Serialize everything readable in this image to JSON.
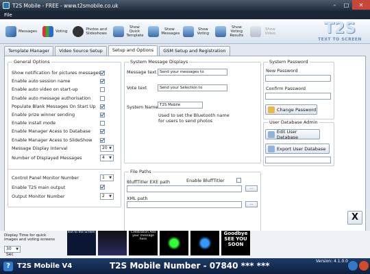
{
  "window": {
    "title": "T2S Mobile - FREE - www.t2smobile.co.uk",
    "menu": "File"
  },
  "toolbar": {
    "messages": "Messages",
    "voting": "Voting",
    "photos": "Photos and Slideshows",
    "show_quick_template": "Show Quick Template",
    "show_messages": "Show Messages",
    "show_voting": "Show Voting",
    "show_voting_results": "Show Voting Results",
    "show_video": "Show Video",
    "logo_text": "T2S",
    "logo_sub": "TEXT TO SCREEN"
  },
  "tabs": [
    "Template Manager",
    "Video Source Setup",
    "Setup and Options",
    "GSM Setup and Registration"
  ],
  "general": {
    "title": "General Options",
    "options": [
      {
        "label": "Show notification for pictures messages",
        "checked": true
      },
      {
        "label": "Enable auto session name",
        "checked": true
      },
      {
        "label": "Enable auto video on start-up",
        "checked": false
      },
      {
        "label": "Enable auto message authorisation",
        "checked": false
      },
      {
        "label": "Populate Blank Messages On Start Up",
        "checked": true
      },
      {
        "label": "Enable prize winner sending",
        "checked": true
      },
      {
        "label": "Enable install mode",
        "checked": false
      },
      {
        "label": "Enable Manager Acess to Database",
        "checked": true
      },
      {
        "label": "Enable Manager Acess to SlideShow",
        "checked": true
      }
    ],
    "interval_label": "Message Display Interval",
    "interval_value": "20",
    "displayed_label": "Number of Displayed Messages",
    "displayed_value": "4",
    "control_panel_label": "Control Panel Monitor Number",
    "control_panel_value": "1",
    "enable_t2s_label": "Enable T2S main output",
    "output_monitor_label": "Output Monitor Number",
    "output_monitor_value": "2"
  },
  "system_message": {
    "title": "System Message Displays",
    "message_text_label": "Message text",
    "message_text_value": "Send your messages to",
    "vote_text_label": "Vote text",
    "vote_text_value": "Send your Selection to",
    "system_name_label": "System Name",
    "system_name_value": "T2S Mobile",
    "hint": "Used to set the Bluetooth name for users to send photos"
  },
  "file_paths": {
    "title": "File Paths",
    "bluff_label": "BluffTitler EXE path",
    "enable_bluff_label": "Enable BluffTitler",
    "xml_label": "XML path",
    "browse": "..."
  },
  "password": {
    "title": "System Password",
    "new_label": "New Password",
    "confirm_label": "Confirm Password",
    "change_button": "Change Password"
  },
  "user_db": {
    "title": "User Database Admin",
    "edit_button": "Edit User Database",
    "export_button": "Export User Database"
  },
  "close_x": "X",
  "bottom": {
    "display_time_label": "Display Time for quick images and voting screens",
    "display_time_value": "30 Sec",
    "thumbs": [
      "Text to the Screen",
      "",
      "Celebration Add your message here",
      "",
      "",
      "Goodbye SEE YOU SOON"
    ]
  },
  "status": {
    "brand": "T2S Mobile V4",
    "number": "T2S Mobile Number - 07840 *** ***",
    "version": "Version: 4.1.0.0"
  }
}
